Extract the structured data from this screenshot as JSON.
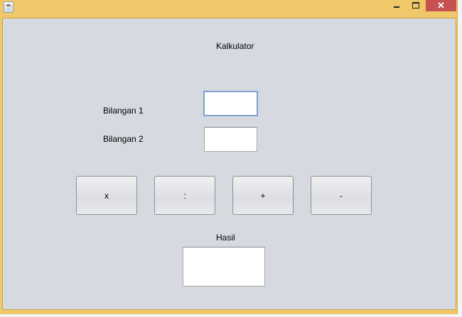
{
  "window": {
    "icon": "java-icon",
    "controls": {
      "minimize": "minimize-icon",
      "maximize": "maximize-icon",
      "close": "close-icon"
    },
    "close_glyph": "✕",
    "titlebar_color": "#f0c869",
    "close_color": "#c75050"
  },
  "form": {
    "title": "Kalkulator",
    "bilangan1_label": "Bilangan 1",
    "bilangan1_value": "",
    "bilangan2_label": "Bilangan 2",
    "bilangan2_value": "",
    "buttons": [
      "x",
      ":",
      "+",
      "-"
    ],
    "hasil_label": "Hasil",
    "hasil_value": ""
  }
}
